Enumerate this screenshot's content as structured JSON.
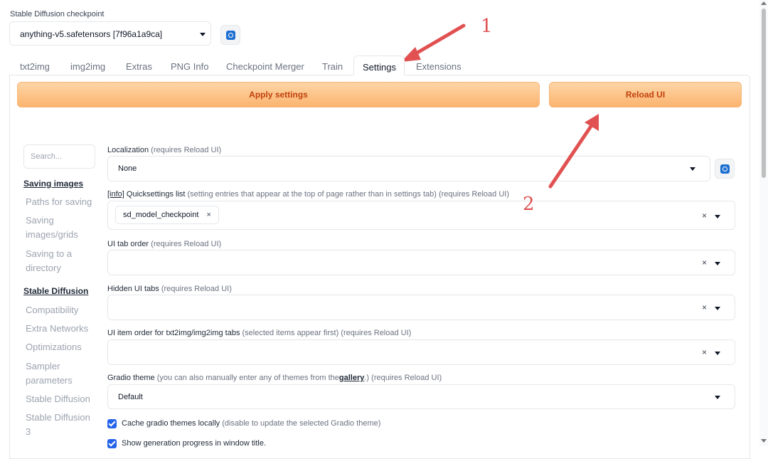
{
  "checkpoint": {
    "label": "Stable Diffusion checkpoint",
    "value": "anything-v5.safetensors [7f96a1a9ca]",
    "refresh_icon": "refresh-icon"
  },
  "tabs": [
    "txt2img",
    "img2img",
    "Extras",
    "PNG Info",
    "Checkpoint Merger",
    "Train",
    "Settings",
    "Extensions"
  ],
  "active_tab": "Settings",
  "buttons": {
    "apply": "Apply settings",
    "reload": "Reload UI"
  },
  "sidebar": {
    "search_placeholder": "Search...",
    "sections": [
      {
        "title": "Saving images",
        "items": [
          "Paths for saving",
          "Saving images/grids",
          "Saving to a directory"
        ]
      },
      {
        "title": "Stable Diffusion",
        "items": [
          "Compatibility",
          "Extra Networks",
          "Optimizations",
          "Sampler parameters",
          "Stable Diffusion",
          "Stable Diffusion 3"
        ]
      }
    ]
  },
  "settings": {
    "localization": {
      "label": "Localization",
      "note": "(requires Reload UI)",
      "value": "None"
    },
    "quicksettings": {
      "info": "[info]",
      "label": "Quicksettings list",
      "note": "(setting entries that appear at the top of page rather than in settings tab) (requires Reload UI)",
      "chip": "sd_model_checkpoint",
      "chip_remove": "×",
      "clear": "×"
    },
    "tab_order": {
      "label": "UI tab order",
      "note": "(requires Reload UI)",
      "clear": "×"
    },
    "hidden_tabs": {
      "label": "Hidden UI tabs",
      "note": "(requires Reload UI)",
      "clear": "×"
    },
    "item_order": {
      "label": "UI item order for txt2img/img2img tabs",
      "note": "(selected items appear first) (requires Reload UI)",
      "clear": "×"
    },
    "gradio_theme": {
      "label": "Gradio theme",
      "note_pre": "(you can also manually enter any of themes from the",
      "link": "gallery",
      "note_post": ".) (requires Reload UI)",
      "value": "Default"
    },
    "cache_themes": {
      "label": "Cache gradio themes locally",
      "note": "(disable to update the selected Gradio theme)",
      "checked": true
    },
    "show_progress": {
      "label": "Show generation progress in window title.",
      "checked": true
    }
  },
  "annotations": {
    "one": "1",
    "two": "2",
    "color": "#e15151"
  },
  "colors": {
    "accent_orange": "#fbb46e",
    "button_text": "#c2410c",
    "checkbox": "#2563eb"
  }
}
